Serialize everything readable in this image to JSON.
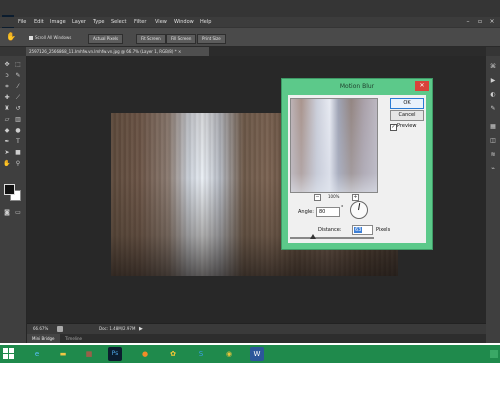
{
  "app": {
    "logo": "Ps",
    "menu": [
      "File",
      "Edit",
      "Image",
      "Layer",
      "Type",
      "Select",
      "Filter",
      "View",
      "Window",
      "Help"
    ]
  },
  "options": {
    "scroll_all_windows": "Scroll All Windows",
    "buttons": [
      "Actual Pixels",
      "Fit Screen",
      "Fill Screen",
      "Print Size"
    ]
  },
  "document": {
    "tab_title": "2597126_2566868_11.Imhfw.vn.lmhfw.vn.jpg @ 66.7% (Layer 1, RGB/8) *"
  },
  "status": {
    "zoom": "66.67%",
    "doc_size": "Doc: 1.48M/2.97M"
  },
  "bottom_tabs": [
    "Mini Bridge",
    "Timeline"
  ],
  "dialog": {
    "title": "Motion Blur",
    "ok": "OK",
    "cancel": "Cancel",
    "preview_label": "Preview",
    "preview_checked": true,
    "zoom": "100%",
    "angle_label": "Angle:",
    "angle_value": "80",
    "angle_unit": "°",
    "distance_label": "Distance:",
    "distance_value": "63",
    "distance_unit": "Pixels"
  },
  "icons": {
    "toolbox": [
      "move-icon",
      "marquee-icon",
      "lasso-icon",
      "quick-select-icon",
      "crop-icon",
      "eyedropper-icon",
      "healing-icon",
      "brush-icon",
      "clone-stamp-icon",
      "history-brush-icon",
      "eraser-icon",
      "gradient-icon",
      "blur-icon",
      "dodge-icon",
      "pen-icon",
      "type-icon",
      "path-select-icon",
      "shape-icon",
      "hand-icon",
      "zoom-icon"
    ],
    "right_panel": [
      "history-icon",
      "actions-icon",
      "adjustments-icon",
      "brushes-icon",
      "styles-icon",
      "layers-icon",
      "channels-icon",
      "paths-icon"
    ],
    "taskbar": [
      "start-icon",
      "ie-icon",
      "explorer-icon",
      "store-icon",
      "photoshop-icon",
      "firefox-icon",
      "paint-icon",
      "skype-icon",
      "chrome-icon",
      "word-icon"
    ]
  },
  "colors": {
    "dialog_frame": "#5cc98a",
    "taskbar": "#1f8a4c",
    "workspace": "#353535"
  }
}
